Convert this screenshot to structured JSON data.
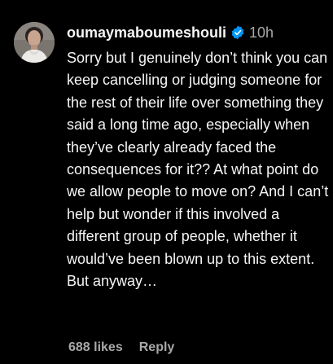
{
  "comment": {
    "username": "oumaymaboumeshouli",
    "verified_icon": "verified-badge-icon",
    "timestamp": "10h",
    "text": "Sorry but I genuinely don’t think you can keep cancelling or judging someone for the rest of their life over something they said a long time ago, especially when they’ve clearly already faced the consequences for it?? At what point do we allow people to move on? And I can’t help but wonder if this involved a different group of people, whether it would’ve been blown up to this extent. But anyway…",
    "likes_label": "688 likes",
    "reply_label": "Reply"
  },
  "colors": {
    "background": "#000000",
    "text_primary": "#f5f5f5",
    "text_secondary": "#a8a8a8",
    "verified_blue": "#0095f6"
  }
}
